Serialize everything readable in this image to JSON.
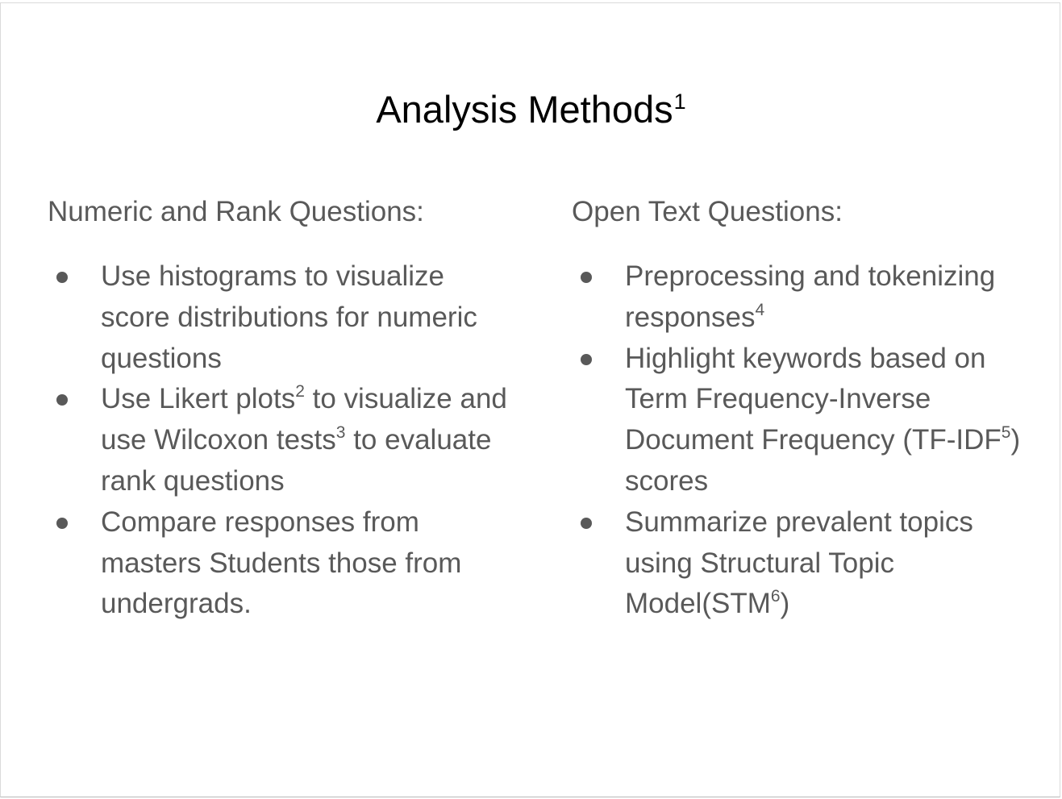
{
  "slide": {
    "title": "Analysis Methods",
    "title_note": "1",
    "left_column": {
      "heading": "Numeric and Rank Questions:",
      "bullets": [
        {
          "parts": [
            "Use histograms to visualize score distributions for numeric questions"
          ]
        },
        {
          "parts": [
            "Use Likert plots",
            "2",
            " to visualize and use Wilcoxon tests",
            "3",
            " to evaluate rank questions"
          ]
        },
        {
          "parts": [
            "Compare responses from masters Students those from undergrads."
          ]
        }
      ]
    },
    "right_column": {
      "heading": "Open Text Questions:",
      "bullets": [
        {
          "parts": [
            "Preprocessing and tokenizing responses",
            "4"
          ]
        },
        {
          "parts": [
            "Highlight keywords based on Term Frequency-Inverse Document Frequency (TF-IDF",
            "5",
            ") scores"
          ]
        },
        {
          "parts": [
            "Summarize prevalent topics using Structural Topic Model(STM",
            "6",
            ")"
          ]
        }
      ]
    }
  },
  "colors": {
    "title_text": "#000000",
    "body_text": "#595959",
    "background": "#ffffff"
  }
}
